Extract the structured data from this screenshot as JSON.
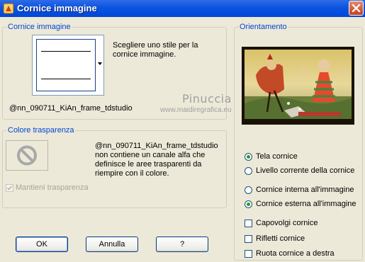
{
  "window": {
    "title": "Cornice immagine",
    "close_label": "×"
  },
  "frame_group": {
    "legend": "Cornice immagine",
    "instruction_line1": "Scegliere uno stile per la",
    "instruction_line2": "cornice immagine.",
    "frame_name": "@nn_090711_KiAn_frame_tdstudio"
  },
  "transparency_group": {
    "legend": "Colore trasparenza",
    "message_lines": [
      "@nn_090711_KiAn_frame_tdstudio",
      "non contiene un canale alfa che",
      "definisce le aree trasparenti da",
      "riempire con il colore."
    ],
    "keep_transparency_label": "Mantieni trasparenza",
    "keep_transparency_checked": true,
    "keep_transparency_disabled": true
  },
  "orientation_group": {
    "legend": "Orientamento",
    "watermark": "Pinuccia",
    "watermark_url": "www.maidiregrafica.eu",
    "radio_group1": [
      {
        "label": "Tela cornice",
        "selected": true
      },
      {
        "label": "Livello corrente della cornice",
        "selected": false
      }
    ],
    "radio_group2": [
      {
        "label": "Cornice interna all'immagine",
        "selected": false
      },
      {
        "label": "Cornice esterna all'immagine",
        "selected": true
      }
    ],
    "checkboxes": [
      {
        "label": "Capovolgi cornice",
        "checked": false
      },
      {
        "label": "Rifletti cornice",
        "checked": false
      },
      {
        "label": "Ruota cornice a destra",
        "checked": false
      }
    ]
  },
  "buttons": {
    "ok": "OK",
    "cancel": "Annulla",
    "help": "?"
  },
  "colors": {
    "titlebar": "#0A55E0",
    "legend_text": "#0046D5",
    "dialog_bg": "#ECE9D8",
    "radio_dot": "#21A121"
  }
}
